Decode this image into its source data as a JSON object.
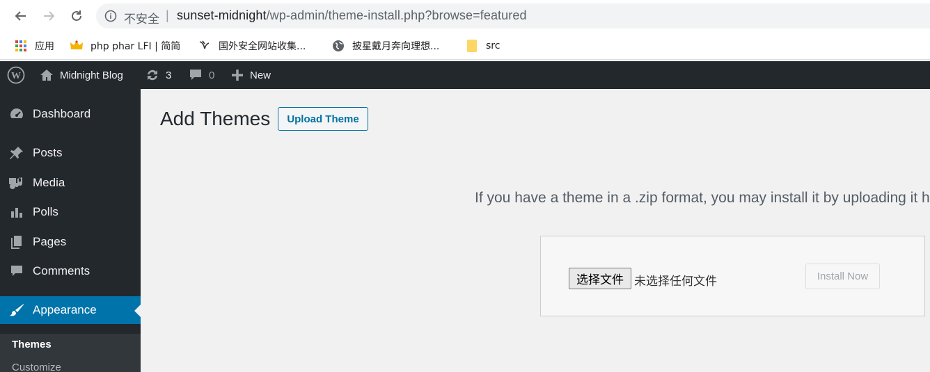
{
  "browser": {
    "insecure_label": "不安全",
    "separator": "|",
    "url_host": "sunset-midnight",
    "url_path": "/wp-admin/theme-install.php?browse=featured",
    "bookmarks": [
      {
        "label": "应用",
        "icon": "apps-grid-icon"
      },
      {
        "label": "php phar LFI | 简简",
        "icon": "crown-icon"
      },
      {
        "label": "国外安全网站收集...",
        "icon": "bird-icon"
      },
      {
        "label": "披星戴月奔向理想...",
        "icon": "globe-icon"
      },
      {
        "label": "src",
        "icon": "folder-icon"
      }
    ]
  },
  "adminbar": {
    "site_name": "Midnight Blog",
    "updates_count": "3",
    "comments_count": "0",
    "new_label": "New"
  },
  "sidebar": {
    "items": [
      {
        "label": "Dashboard",
        "icon": "dashboard-icon"
      },
      {
        "label": "Posts",
        "icon": "pushpin-icon"
      },
      {
        "label": "Media",
        "icon": "media-icon"
      },
      {
        "label": "Polls",
        "icon": "bar-chart-icon"
      },
      {
        "label": "Pages",
        "icon": "pages-icon"
      },
      {
        "label": "Comments",
        "icon": "comment-icon"
      },
      {
        "label": "Appearance",
        "icon": "paintbrush-icon"
      }
    ],
    "submenu": [
      {
        "label": "Themes"
      },
      {
        "label": "Customize"
      }
    ]
  },
  "main": {
    "title": "Add Themes",
    "upload_button": "Upload Theme",
    "help_text": "If you have a theme in a .zip format, you may install it by uploading it here.",
    "choose_file": "选择文件",
    "no_file": "未选择任何文件",
    "install_button": "Install Now"
  },
  "colors": {
    "admin_bar": "#23282d",
    "accent": "#0073aa",
    "background": "#f1f1f1"
  }
}
